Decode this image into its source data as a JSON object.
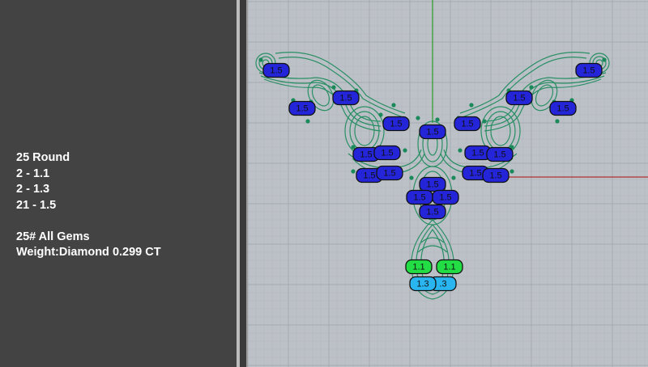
{
  "summary": {
    "line1": "25 Round",
    "line2": "2 - 1.1",
    "line3": "2 - 1.3",
    "line4": "21 - 1.5",
    "line5": "25# All Gems",
    "line6": "Weight:Diamond 0.299 CT"
  },
  "stone_labels": {
    "small": "1.1",
    "medium": "1.3",
    "large": "1.5",
    "medium_partial": ".3"
  },
  "colors": {
    "gem_1_5": "#2424d8",
    "gem_1_1": "#22dd44",
    "gem_1_3": "#29b6f0",
    "wire": "#1a8a5a",
    "x_axis": "#b03030",
    "y_axis": "#2a9a2a"
  }
}
